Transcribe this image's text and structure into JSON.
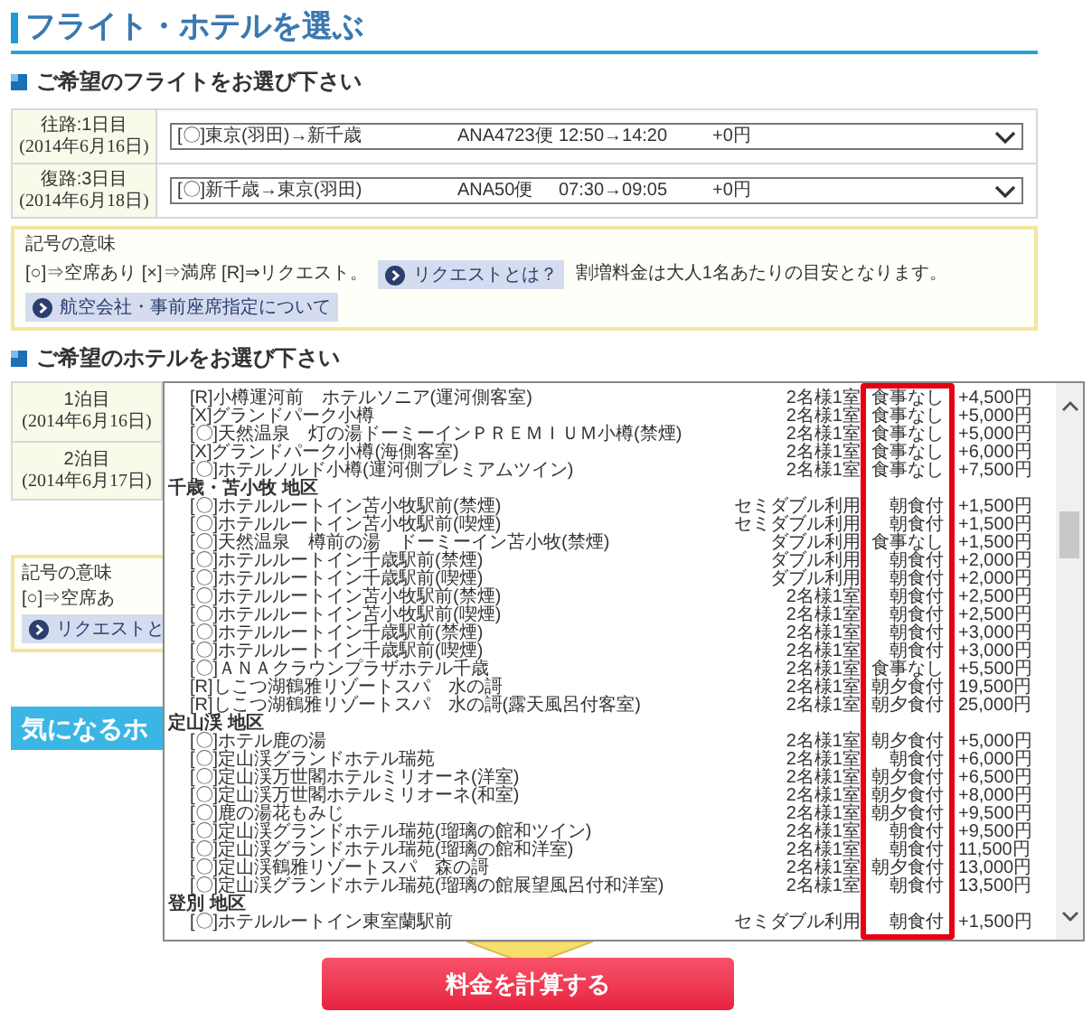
{
  "page_title": "フライト・ホテルを選ぶ",
  "flight_section": {
    "heading": "ご希望のフライトをお選び下さい",
    "rows": [
      {
        "label": "往路:1日目",
        "date": "(2014年6月16日)",
        "route": "[〇]東京(羽田)→新千歳",
        "flight": "ANA4723便",
        "time": "12:50→14:20",
        "price": "+0円"
      },
      {
        "label": "復路:3日目",
        "date": "(2014年6月18日)",
        "route": "[〇]新千歳→東京(羽田)",
        "flight": "ANA50便",
        "time": "07:30→09:05",
        "price": "+0円"
      }
    ]
  },
  "legend": {
    "title": "記号の意味",
    "text": "[○]⇒空席あり [×]⇒満席 [R]⇒リクエスト。",
    "request_button": "リクエストとは？",
    "note": "割増料金は大人1名あたりの目安となります。",
    "airline_button": "航空会社・事前座席指定について"
  },
  "hotel_section": {
    "heading": "ご希望のホテルをお選び下さい",
    "nights": [
      {
        "label": "1泊目",
        "date": "(2014年6月16日)"
      },
      {
        "label": "2泊目",
        "date": "(2014年6月17日)"
      }
    ],
    "legend_partial": {
      "title": "記号の意味",
      "text": "[○]⇒空席あ",
      "request_button": "リクエストと"
    },
    "banner": "気になるホ",
    "dropdown": {
      "items": [
        {
          "kind": "hotel",
          "name": "[R]小樽運河前　ホテルソニア(運河側客室)",
          "room": "2名様1室",
          "meal": "食事なし",
          "price": "+4,500円"
        },
        {
          "kind": "hotel",
          "name": "[X]グランドパーク小樽",
          "room": "2名様1室",
          "meal": "食事なし",
          "price": "+5,000円"
        },
        {
          "kind": "hotel",
          "name": "[〇]天然温泉　灯の湯ドーミーインＰＲＥＭＩＵＭ小樽(禁煙)",
          "room": "2名様1室",
          "meal": "食事なし",
          "price": "+5,000円"
        },
        {
          "kind": "hotel",
          "name": "[X]グランドパーク小樽(海側客室)",
          "room": "2名様1室",
          "meal": "食事なし",
          "price": "+6,000円"
        },
        {
          "kind": "hotel",
          "name": "[〇]ホテルノルド小樽(運河側プレミアムツイン)",
          "room": "2名様1室",
          "meal": "食事なし",
          "price": "+7,500円"
        },
        {
          "kind": "area",
          "name": "千歳・苫小牧 地区"
        },
        {
          "kind": "hotel",
          "name": "[〇]ホテルルートイン苫小牧駅前(禁煙)",
          "room": "セミダブル利用",
          "meal": "朝食付",
          "price": "+1,500円"
        },
        {
          "kind": "hotel",
          "name": "[〇]ホテルルートイン苫小牧駅前(喫煙)",
          "room": "セミダブル利用",
          "meal": "朝食付",
          "price": "+1,500円"
        },
        {
          "kind": "hotel",
          "name": "[〇]天然温泉　樽前の湯　ドーミーイン苫小牧(禁煙)",
          "room": "ダブル利用",
          "meal": "食事なし",
          "price": "+1,500円"
        },
        {
          "kind": "hotel",
          "name": "[〇]ホテルルートイン千歳駅前(禁煙)",
          "room": "ダブル利用",
          "meal": "朝食付",
          "price": "+2,000円"
        },
        {
          "kind": "hotel",
          "name": "[〇]ホテルルートイン千歳駅前(喫煙)",
          "room": "ダブル利用",
          "meal": "朝食付",
          "price": "+2,000円"
        },
        {
          "kind": "hotel",
          "name": "[〇]ホテルルートイン苫小牧駅前(禁煙)",
          "room": "2名様1室",
          "meal": "朝食付",
          "price": "+2,500円"
        },
        {
          "kind": "hotel",
          "name": "[〇]ホテルルートイン苫小牧駅前(喫煙)",
          "room": "2名様1室",
          "meal": "朝食付",
          "price": "+2,500円"
        },
        {
          "kind": "hotel",
          "name": "[〇]ホテルルートイン千歳駅前(禁煙)",
          "room": "2名様1室",
          "meal": "朝食付",
          "price": "+3,000円"
        },
        {
          "kind": "hotel",
          "name": "[〇]ホテルルートイン千歳駅前(喫煙)",
          "room": "2名様1室",
          "meal": "朝食付",
          "price": "+3,000円"
        },
        {
          "kind": "hotel",
          "name": "[〇]ＡＮＡクラウンプラザホテル千歳",
          "room": "2名様1室",
          "meal": "食事なし",
          "price": "+5,500円"
        },
        {
          "kind": "hotel",
          "name": "[R]しこつ湖鶴雅リゾートスパ　水の謌",
          "room": "2名様1室",
          "meal": "朝夕食付",
          "price": "19,500円"
        },
        {
          "kind": "hotel",
          "name": "[R]しこつ湖鶴雅リゾートスパ　水の謌(露天風呂付客室)",
          "room": "2名様1室",
          "meal": "朝夕食付",
          "price": "25,000円"
        },
        {
          "kind": "area",
          "name": "定山渓 地区"
        },
        {
          "kind": "hotel",
          "name": "[〇]ホテル鹿の湯",
          "room": "2名様1室",
          "meal": "朝夕食付",
          "price": "+5,000円"
        },
        {
          "kind": "hotel",
          "name": "[〇]定山渓グランドホテル瑞苑",
          "room": "2名様1室",
          "meal": "朝食付",
          "price": "+6,000円"
        },
        {
          "kind": "hotel",
          "name": "[〇]定山渓万世閣ホテルミリオーネ(洋室)",
          "room": "2名様1室",
          "meal": "朝夕食付",
          "price": "+6,500円"
        },
        {
          "kind": "hotel",
          "name": "[〇]定山渓万世閣ホテルミリオーネ(和室)",
          "room": "2名様1室",
          "meal": "朝夕食付",
          "price": "+8,000円"
        },
        {
          "kind": "hotel",
          "name": "[〇]鹿の湯花もみじ",
          "room": "2名様1室",
          "meal": "朝夕食付",
          "price": "+9,500円"
        },
        {
          "kind": "hotel",
          "name": "[〇]定山渓グランドホテル瑞苑(瑠璃の館和ツイン)",
          "room": "2名様1室",
          "meal": "朝食付",
          "price": "+9,500円"
        },
        {
          "kind": "hotel",
          "name": "[〇]定山渓グランドホテル瑞苑(瑠璃の館和洋室)",
          "room": "2名様1室",
          "meal": "朝食付",
          "price": "11,500円"
        },
        {
          "kind": "hotel",
          "name": "[〇]定山渓鶴雅リゾートスパ　森の謌",
          "room": "2名様1室",
          "meal": "朝夕食付",
          "price": "13,000円"
        },
        {
          "kind": "hotel",
          "name": "[〇]定山渓グランドホテル瑞苑(瑠璃の館展望風呂付和洋室)",
          "room": "2名様1室",
          "meal": "朝食付",
          "price": "13,500円"
        },
        {
          "kind": "area",
          "name": "登別 地区"
        },
        {
          "kind": "hotel",
          "name": "[〇]ホテルルートイン東室蘭駅前",
          "room": "セミダブル利用",
          "meal": "朝食付",
          "price": "+1,500円"
        }
      ]
    }
  },
  "calculate_button": "料金を計算する"
}
